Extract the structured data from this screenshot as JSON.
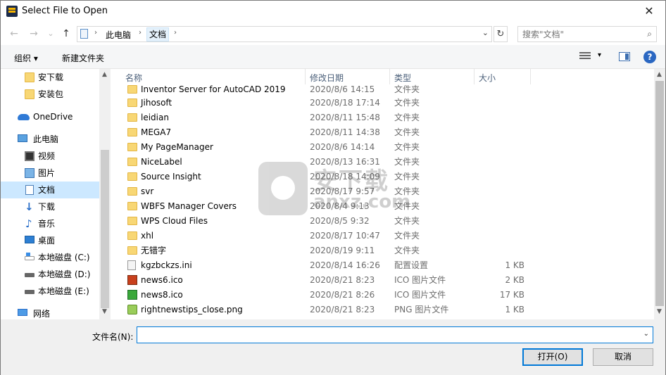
{
  "window": {
    "title": "Select File to Open",
    "close_glyph": "✕"
  },
  "nav": {
    "back_glyph": "←",
    "forward_glyph": "→",
    "recent_glyph": "⌄",
    "up_glyph": "↑",
    "breadcrumb": [
      "此电脑",
      "文档"
    ],
    "crumb_sep": "›",
    "refresh_glyph": "↻",
    "search_placeholder": "搜索\"文档\"",
    "search_glyph": "⌕",
    "dropdown_glyph": "⌄"
  },
  "toolbar": {
    "organize_label": "组织 ▾",
    "new_folder_label": "新建文件夹",
    "view_drop": "▾",
    "help_glyph": "?"
  },
  "sidebar": {
    "items": [
      {
        "label": "安下载",
        "icon": "folder-icon"
      },
      {
        "label": "安装包",
        "icon": "folder-icon"
      },
      {
        "label": "OneDrive",
        "icon": "cloud-icon"
      },
      {
        "label": "此电脑",
        "icon": "pc-icon"
      },
      {
        "label": "视频",
        "icon": "video-icon"
      },
      {
        "label": "图片",
        "icon": "picture-icon"
      },
      {
        "label": "文档",
        "icon": "document-icon"
      },
      {
        "label": "下载",
        "icon": "download-icon"
      },
      {
        "label": "音乐",
        "icon": "music-icon"
      },
      {
        "label": "桌面",
        "icon": "desktop-icon"
      },
      {
        "label": "本地磁盘 (C:)",
        "icon": "disk-c-icon"
      },
      {
        "label": "本地磁盘 (D:)",
        "icon": "disk-icon"
      },
      {
        "label": "本地磁盘 (E:)",
        "icon": "disk-icon"
      },
      {
        "label": "网络",
        "icon": "network-icon"
      }
    ],
    "selected": "文档"
  },
  "filelist": {
    "columns": [
      "名称",
      "修改日期",
      "类型",
      "大小"
    ],
    "sort_caret": "^",
    "rows": [
      {
        "name": "Inventor Server for AutoCAD 2019",
        "date": "2020/8/6 14:15",
        "type": "文件夹",
        "size": "",
        "icon": "folder"
      },
      {
        "name": "Jihosoft",
        "date": "2020/8/18 17:14",
        "type": "文件夹",
        "size": "",
        "icon": "folder"
      },
      {
        "name": "leidian",
        "date": "2020/8/11 15:48",
        "type": "文件夹",
        "size": "",
        "icon": "folder"
      },
      {
        "name": "MEGA7",
        "date": "2020/8/11 14:38",
        "type": "文件夹",
        "size": "",
        "icon": "folder"
      },
      {
        "name": "My PageManager",
        "date": "2020/8/6 14:14",
        "type": "文件夹",
        "size": "",
        "icon": "folder"
      },
      {
        "name": "NiceLabel",
        "date": "2020/8/13 16:31",
        "type": "文件夹",
        "size": "",
        "icon": "folder"
      },
      {
        "name": "Source Insight",
        "date": "2020/8/18 14:09",
        "type": "文件夹",
        "size": "",
        "icon": "folder"
      },
      {
        "name": "svr",
        "date": "2020/8/17 9:57",
        "type": "文件夹",
        "size": "",
        "icon": "folder"
      },
      {
        "name": "WBFS Manager Covers",
        "date": "2020/8/4 9:13",
        "type": "文件夹",
        "size": "",
        "icon": "folder"
      },
      {
        "name": "WPS Cloud Files",
        "date": "2020/8/5 9:32",
        "type": "文件夹",
        "size": "",
        "icon": "folder"
      },
      {
        "name": "xhl",
        "date": "2020/8/17 10:47",
        "type": "文件夹",
        "size": "",
        "icon": "folder"
      },
      {
        "name": "无错字",
        "date": "2020/8/19 9:11",
        "type": "文件夹",
        "size": "",
        "icon": "folder"
      },
      {
        "name": "kgzbckzs.ini",
        "date": "2020/8/14 16:26",
        "type": "配置设置",
        "size": "1 KB",
        "icon": "ini"
      },
      {
        "name": "news6.ico",
        "date": "2020/8/21 8:23",
        "type": "ICO 图片文件",
        "size": "2 KB",
        "icon": "ico1"
      },
      {
        "name": "news8.ico",
        "date": "2020/8/21 8:26",
        "type": "ICO 图片文件",
        "size": "17 KB",
        "icon": "ico2"
      },
      {
        "name": "rightnewstips_close.png",
        "date": "2020/8/21 8:23",
        "type": "PNG 图片文件",
        "size": "1 KB",
        "icon": "png"
      }
    ]
  },
  "watermark": {
    "text": "安下载",
    "sub": "anxz.com"
  },
  "bottom": {
    "filename_label": "文件名(N):",
    "filename_value": "",
    "open_label": "打开(O)",
    "cancel_label": "取消",
    "drop_glyph": "⌄"
  },
  "scroll": {
    "up": "▲",
    "down": "▼"
  }
}
